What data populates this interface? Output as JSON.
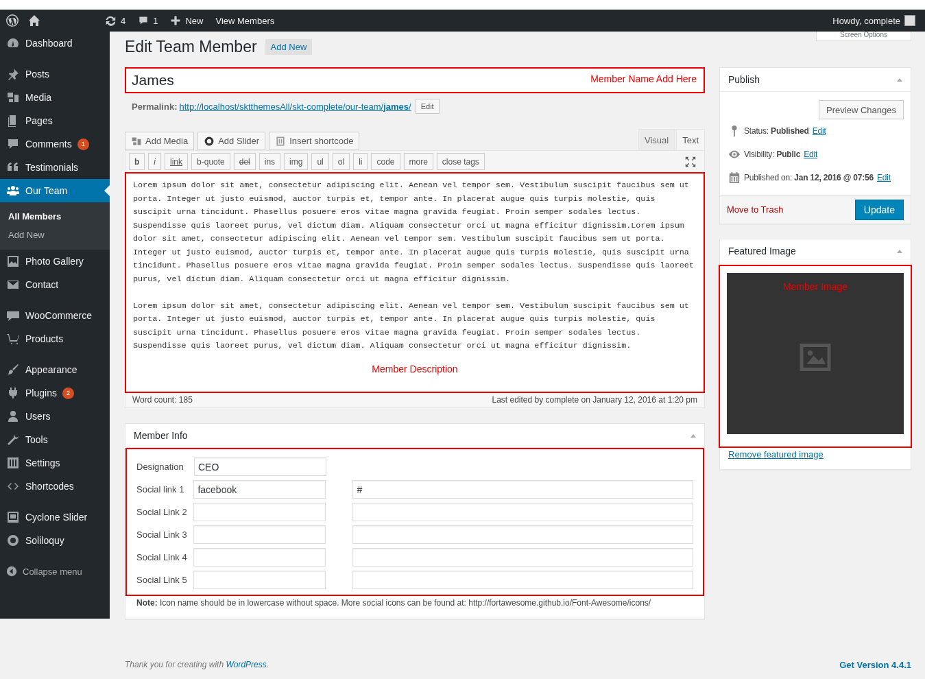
{
  "admin_bar": {
    "updates": "4",
    "comments": "1",
    "new_label": "New",
    "view_label": "View Members",
    "greeting": "Howdy, complete"
  },
  "sidebar": {
    "groups": [
      [
        {
          "label": "Dashboard",
          "selected": false
        }
      ],
      [
        {
          "label": "Posts",
          "selected": false
        },
        {
          "label": "Media",
          "selected": false
        },
        {
          "label": "Pages",
          "selected": false
        },
        {
          "label": "Comments",
          "badge": "1",
          "selected": false
        },
        {
          "label": "Testimonials",
          "selected": false
        },
        {
          "label": "Our Team",
          "selected": true,
          "children": [
            {
              "label": "All Members",
              "selected": true
            },
            {
              "label": "Add New",
              "selected": false
            }
          ]
        },
        {
          "label": "Photo Gallery",
          "selected": false
        },
        {
          "label": "Contact",
          "selected": false
        }
      ],
      [
        {
          "label": "WooCommerce",
          "selected": false
        },
        {
          "label": "Products",
          "selected": false
        }
      ],
      [
        {
          "label": "Appearance",
          "selected": false
        },
        {
          "label": "Plugins",
          "badge": "2",
          "selected": false
        },
        {
          "label": "Users",
          "selected": false
        },
        {
          "label": "Tools",
          "selected": false
        },
        {
          "label": "Settings",
          "selected": false
        },
        {
          "label": "Shortcodes",
          "selected": false
        }
      ],
      [
        {
          "label": "Cyclone Slider",
          "selected": false
        },
        {
          "label": "Soliloquy",
          "selected": false
        }
      ]
    ],
    "collapse_label": "Collapse menu"
  },
  "screen_options": "Screen Options",
  "page_title": "Edit Team Member",
  "add_new": "Add New",
  "title_field": {
    "value": "James",
    "annotation": "Member Name Add Here"
  },
  "permalink": {
    "label": "Permalink:",
    "url": "http://localhost/sktthemesAll/skt-complete/our-team/",
    "slug": "james",
    "suffix": "/",
    "edit": "Edit"
  },
  "media_buttons": [
    "Add Media",
    "Add Slider",
    "Insert shortcode"
  ],
  "editor_tabs": [
    {
      "label": "Visual",
      "selected": false
    },
    {
      "label": "Text",
      "selected": true
    }
  ],
  "quicktags": [
    "b",
    "i",
    "link",
    "b-quote",
    "del",
    "ins",
    "img",
    "ul",
    "ol",
    "li",
    "code",
    "more",
    "close tags"
  ],
  "content": [
    "Lorem ipsum dolor sit amet, consectetur adipiscing elit. Aenean vel tempor sem. Vestibulum suscipit faucibus sem ut porta. Integer ut justo euismod, auctor turpis et, tempor ante. In placerat augue quis turpis molestie, quis suscipit urna tincidunt. Phasellus posuere eros vitae magna gravida feugiat. Proin semper sodales lectus. Suspendisse quis laoreet purus, vel dictum diam. Aliquam consectetur orci ut magna efficitur dignissim.Lorem ipsum dolor sit amet, consectetur adipiscing elit. Aenean vel tempor sem. Vestibulum suscipit faucibus sem ut porta. Integer ut justo euismod, auctor turpis et, tempor ante. In placerat augue quis turpis molestie, quis suscipit urna tincidunt. Phasellus posuere eros vitae magna gravida feugiat. Proin semper sodales lectus. Suspendisse quis laoreet purus, vel dictum diam. Aliquam consectetur orci ut magna efficitur dignissim.",
    "Lorem ipsum dolor sit amet, consectetur adipiscing elit. Aenean vel tempor sem. Vestibulum suscipit faucibus sem ut porta. Integer ut justo euismod, auctor turpis et, tempor ante. In placerat augue quis turpis molestie, quis suscipit urna tincidunt. Phasellus posuere eros vitae magna gravida feugiat. Proin semper sodales lectus. Suspendisse quis laoreet purus, vel dictum diam. Aliquam consectetur orci ut magna efficitur dignissim."
  ],
  "content_annotation": "Member Description",
  "word_count": "Word count: 185",
  "last_edited": "Last edited by complete on January 12, 2016 at 1:20 pm",
  "member_info": {
    "title": "Member Info",
    "rows": [
      {
        "kind": "single",
        "label": "Designation",
        "value": "CEO"
      },
      {
        "kind": "pair",
        "label": "Social link 1",
        "value": "facebook",
        "url": "#"
      },
      {
        "kind": "pair",
        "label": "Social Link 2"
      },
      {
        "kind": "pair",
        "label": "Social Link 3"
      },
      {
        "kind": "pair",
        "label": "Social Link 4"
      },
      {
        "kind": "pair",
        "label": "Social Link 5"
      }
    ],
    "note": "**Note:** Icon name should be in lowercase without space. More social icons can be found at: http://fortawesome.github.io/Font-Awesome/icons/"
  },
  "publish": {
    "title": "Publish",
    "preview": "Preview Changes",
    "lines": [
      {
        "kind": "status",
        "text": "Status: **Published**",
        "edit": "Edit"
      },
      {
        "kind": "visibility",
        "text": "Visibility: **Public**",
        "edit": "Edit"
      },
      {
        "kind": "date",
        "text": "Published on: **Jan 12, 2016 @ 07:56**",
        "edit": "Edit"
      }
    ],
    "trash": "Move to Trash",
    "update": "Update"
  },
  "featured_image": {
    "title": "Featured Image",
    "annotation": "Member Image",
    "remove": "Remove featured image"
  },
  "footer": {
    "thanks": "Thank you for creating with",
    "link": "WordPress",
    "period": ".",
    "version": "Get Version 4.4.1"
  }
}
